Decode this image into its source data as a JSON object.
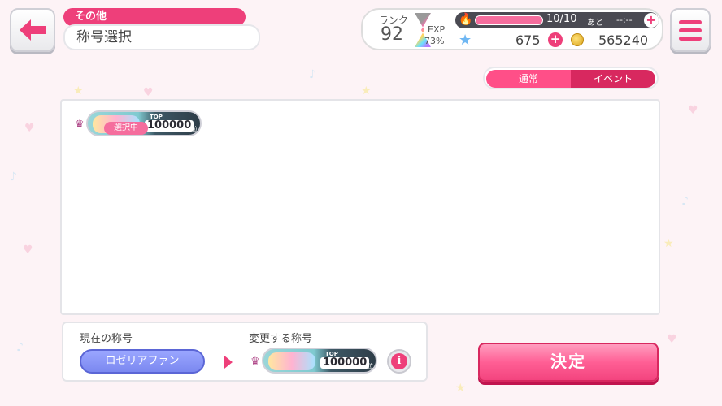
{
  "header": {
    "category": "その他",
    "title": "称号選択"
  },
  "status": {
    "rank_label": "ランク",
    "rank_value": "92",
    "exp_label": "EXP",
    "exp_value": "73%",
    "stamina": "10/10",
    "stamina_ato": "あと",
    "stamina_timer": "--:--",
    "star_count": "675",
    "coin_count": "565240"
  },
  "tabs": [
    {
      "label": "通常",
      "active": true
    },
    {
      "label": "イベント",
      "active": false
    }
  ],
  "titles": [
    {
      "top": "TOP",
      "number": "100000",
      "rank_suffix": "位",
      "selected_label": "選択中"
    }
  ],
  "current": {
    "label": "現在の称号",
    "value": "ロゼリアファン"
  },
  "change": {
    "label": "変更する称号",
    "top": "TOP",
    "number": "100000",
    "rank_suffix": "位"
  },
  "confirm_label": "決定",
  "colors": {
    "accent": "#ee3f7a",
    "tab_active": "#ff4f88",
    "tab_inactive": "#d8285f",
    "current_title_bg": "#8a96f6"
  },
  "icons": {
    "back": "arrow-left-icon",
    "menu": "hamburger-icon",
    "stamina": "flame-icon",
    "stars": "star-icon",
    "coins": "coin-icon",
    "crown": "crown-icon",
    "info": "info-icon"
  }
}
